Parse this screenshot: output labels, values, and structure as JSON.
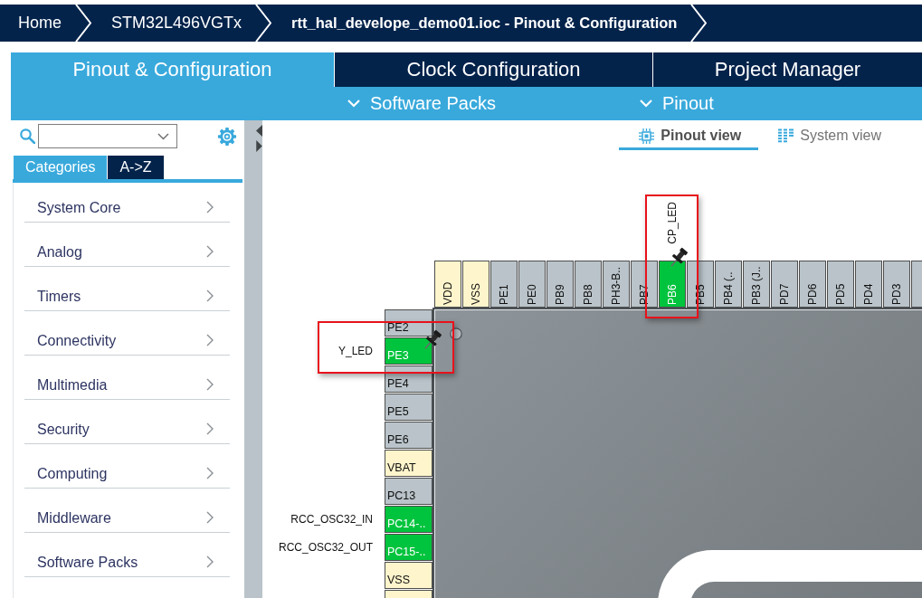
{
  "breadcrumb": [
    {
      "label": "Home",
      "current": false
    },
    {
      "label": "STM32L496VGTx",
      "current": false
    },
    {
      "label": "rtt_hal_develope_demo01.ioc - Pinout & Configuration",
      "current": true
    }
  ],
  "tabs": [
    {
      "label": "Pinout & Configuration",
      "selected": true
    },
    {
      "label": "Clock Configuration",
      "selected": false
    },
    {
      "label": "Project Manager",
      "selected": false
    }
  ],
  "menus": [
    {
      "label": "Software Packs"
    },
    {
      "label": "Pinout"
    }
  ],
  "sidebar": {
    "tabs": [
      {
        "label": "Categories",
        "selected": true
      },
      {
        "label": "A->Z",
        "selected": false
      }
    ],
    "categories": [
      {
        "label": "System Core"
      },
      {
        "label": "Analog"
      },
      {
        "label": "Timers"
      },
      {
        "label": "Connectivity"
      },
      {
        "label": "Multimedia"
      },
      {
        "label": "Security"
      },
      {
        "label": "Computing"
      },
      {
        "label": "Middleware"
      },
      {
        "label": "Software Packs"
      }
    ]
  },
  "view_tabs": [
    {
      "label": "Pinout view",
      "kind": "pinout",
      "selected": true
    },
    {
      "label": "System view",
      "kind": "system",
      "selected": false
    }
  ],
  "chip": {
    "top_pins": [
      {
        "name": "VDD",
        "kind": "power",
        "pinned": false,
        "highlighted": false
      },
      {
        "name": "VSS",
        "kind": "power",
        "pinned": false,
        "highlighted": false
      },
      {
        "name": "PE1",
        "kind": "free",
        "pinned": false,
        "highlighted": false
      },
      {
        "name": "PE0",
        "kind": "free",
        "pinned": false,
        "highlighted": false
      },
      {
        "name": "PB9",
        "kind": "free",
        "pinned": false,
        "highlighted": false
      },
      {
        "name": "PB8",
        "kind": "free",
        "pinned": false,
        "highlighted": false
      },
      {
        "name": "PH3-B..",
        "kind": "free",
        "pinned": false,
        "highlighted": false
      },
      {
        "name": "PB7",
        "kind": "free",
        "pinned": false,
        "highlighted": false
      },
      {
        "name": "PB6",
        "kind": "assigned",
        "signal": "CP_LED",
        "pinned": true,
        "highlighted": true
      },
      {
        "name": "PB5",
        "kind": "free",
        "pinned": false,
        "highlighted": false
      },
      {
        "name": "PB4 (..",
        "kind": "free",
        "pinned": false,
        "highlighted": false
      },
      {
        "name": "PB3 (J..",
        "kind": "free",
        "pinned": false,
        "highlighted": false
      },
      {
        "name": "PD7",
        "kind": "free",
        "pinned": false,
        "highlighted": false
      },
      {
        "name": "PD6",
        "kind": "free",
        "pinned": false,
        "highlighted": false
      },
      {
        "name": "PD5",
        "kind": "free",
        "pinned": false,
        "highlighted": false
      },
      {
        "name": "PD4",
        "kind": "free",
        "pinned": false,
        "highlighted": false
      },
      {
        "name": "PD3",
        "kind": "free",
        "pinned": false,
        "highlighted": false
      },
      {
        "kind": "free",
        "pinned": false,
        "highlighted": false
      }
    ],
    "left_pins": [
      {
        "name": "PE2",
        "kind": "free",
        "pinned": false,
        "highlighted": false
      },
      {
        "name": "PE3",
        "kind": "assigned",
        "signal": "Y_LED",
        "pinned": true,
        "highlighted": true
      },
      {
        "name": "PE4",
        "kind": "free",
        "pinned": false,
        "highlighted": false
      },
      {
        "name": "PE5",
        "kind": "free",
        "pinned": false,
        "highlighted": false
      },
      {
        "name": "PE6",
        "kind": "free",
        "pinned": false,
        "highlighted": false
      },
      {
        "name": "VBAT",
        "kind": "power",
        "pinned": false,
        "highlighted": false
      },
      {
        "name": "PC13",
        "kind": "free",
        "pinned": false,
        "highlighted": false
      },
      {
        "name": "PC14-..",
        "kind": "assigned",
        "signal": "RCC_OSC32_IN",
        "pinned": false,
        "highlighted": false
      },
      {
        "name": "PC15-..",
        "kind": "assigned",
        "signal": "RCC_OSC32_OUT",
        "pinned": false,
        "highlighted": false
      },
      {
        "name": "VSS",
        "kind": "power",
        "pinned": false,
        "highlighted": false
      },
      {
        "kind": "power",
        "pinned": false,
        "highlighted": false
      }
    ]
  }
}
